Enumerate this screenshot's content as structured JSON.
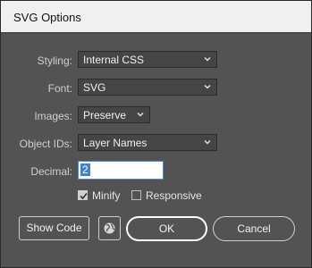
{
  "window": {
    "title": "SVG Options"
  },
  "fields": {
    "styling": {
      "label": "Styling:",
      "value": "Internal CSS"
    },
    "font": {
      "label": "Font:",
      "value": "SVG"
    },
    "images": {
      "label": "Images:",
      "value": "Preserve"
    },
    "object_ids": {
      "label": "Object IDs:",
      "value": "Layer Names"
    },
    "decimal": {
      "label": "Decimal:",
      "value": "2"
    }
  },
  "checkboxes": {
    "minify": {
      "label": "Minify",
      "checked": true
    },
    "responsive": {
      "label": "Responsive",
      "checked": false
    }
  },
  "buttons": {
    "show_code": "Show Code",
    "ok": "OK",
    "cancel": "Cancel"
  },
  "icons": {
    "dropdown": "chevron-down-icon",
    "web": "globe-icon",
    "check": "checkmark-icon"
  },
  "colors": {
    "panel": "#535353",
    "control": "#454545",
    "selection": "#3d82d6"
  }
}
